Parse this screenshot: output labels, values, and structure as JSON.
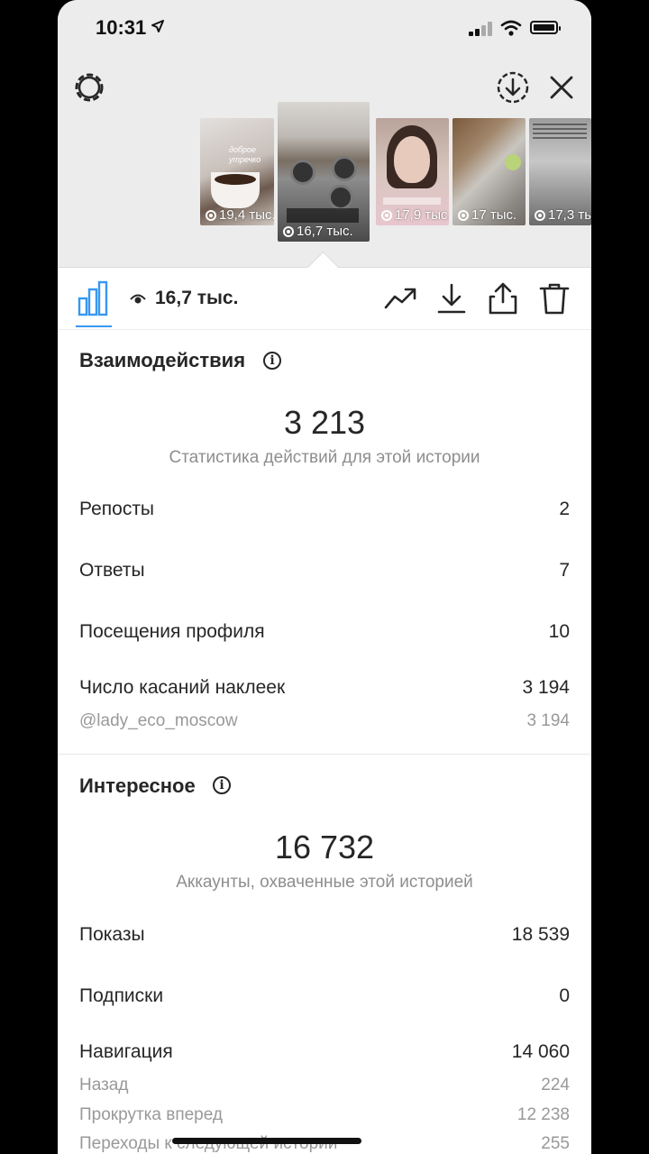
{
  "status_bar": {
    "time": "10:31"
  },
  "thumbnails": [
    {
      "views": "19,4 тыс.",
      "caption": "доброе утречко",
      "selected": false
    },
    {
      "views": "16,7 тыс.",
      "selected": true
    },
    {
      "views": "17,9 тыс.",
      "selected": false
    },
    {
      "views": "17 тыс.",
      "selected": false
    },
    {
      "views": "17,3 тыс.",
      "selected": false
    }
  ],
  "toolbar": {
    "views_count": "16,7 тыс."
  },
  "interactions": {
    "title": "Взаимодействия",
    "total": "3 213",
    "subtitle": "Статистика действий для этой истории",
    "rows": [
      {
        "label": "Репосты",
        "value": "2"
      },
      {
        "label": "Ответы",
        "value": "7"
      },
      {
        "label": "Посещения профиля",
        "value": "10"
      },
      {
        "label": "Число касаний наклеек",
        "value": "3 194"
      }
    ],
    "sticker": {
      "label": "@lady_eco_moscow",
      "value": "3 194"
    }
  },
  "discovery": {
    "title": "Интересное",
    "total": "16 732",
    "subtitle": "Аккаунты, охваченные этой историей",
    "rows": [
      {
        "label": "Показы",
        "value": "18 539"
      },
      {
        "label": "Подписки",
        "value": "0"
      },
      {
        "label": "Навигация",
        "value": "14 060"
      }
    ],
    "navigation_sub": [
      {
        "label": "Назад",
        "value": "224"
      },
      {
        "label": "Прокрутка вперед",
        "value": "12 238"
      },
      {
        "label": "Переходы к следующей истории",
        "value": "255"
      }
    ]
  },
  "colors": {
    "accent": "#3897f0",
    "text": "#262626",
    "muted": "#8e8e8e"
  }
}
